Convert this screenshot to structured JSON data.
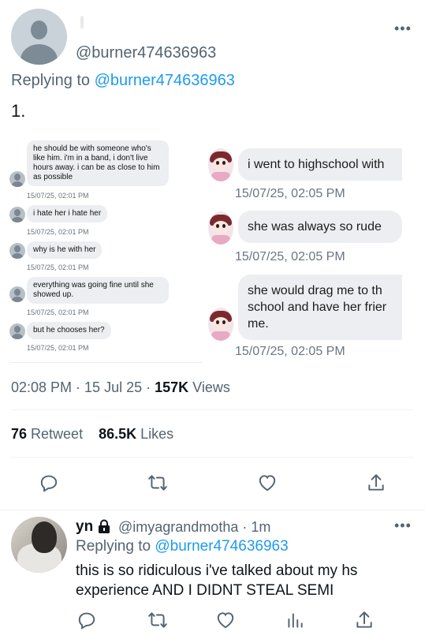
{
  "tweet": {
    "author_handle": "@burner474636963",
    "replying_prefix": "Replying to ",
    "replying_to": "@burner474636963",
    "text": "1.",
    "more": "•••",
    "time": "02:08 PM",
    "sep1": " · ",
    "date": "15 Jul 25",
    "sep2": " · ",
    "views_count": "157K",
    "views_label": " Views",
    "retweets_count": "76",
    "retweets_label": " Retweet",
    "likes_count": "86.5K",
    "likes_label": " Likes"
  },
  "screenshot_left": [
    {
      "text": "he should be with someone who's like him. i'm in a band, i don't live hours away. i can be as close to him as possible",
      "time": "15/07/25, 02:01 PM"
    },
    {
      "text": "i hate her i hate her",
      "time": "15/07/25, 02:01 PM"
    },
    {
      "text": "why is he with her",
      "time": "15/07/25, 02:01 PM"
    },
    {
      "text": "everything was going fine until she showed up.",
      "time": "15/07/25, 02:01 PM"
    },
    {
      "text": "but he chooses her?",
      "time": "15/07/25, 02:01 PM"
    }
  ],
  "screenshot_right": [
    {
      "text": "i went to highschool with",
      "time": "15/07/25, 02:05 PM"
    },
    {
      "text": "she was always so rude",
      "time": "15/07/25, 02:05 PM"
    },
    {
      "text": "she would drag me to th\nschool and have her frier\nme.",
      "time": "15/07/25, 02:05 PM"
    }
  ],
  "reply": {
    "name": "yn",
    "handle_time": "@imyagrandmotha · 1m",
    "more": "•••",
    "replying_prefix": "Replying to ",
    "replying_to": "@burner474636963",
    "text": "this is so ridiculous i've talked about my hs experience AND I DIDNT STEAL SEMI"
  },
  "colors": {
    "accent": "#1d9bf0",
    "secondary_text": "#536471",
    "bubble": "#eceef1"
  },
  "icons": [
    "reply-icon",
    "retweet-icon",
    "like-icon",
    "share-icon",
    "views-icon",
    "lock-icon"
  ]
}
